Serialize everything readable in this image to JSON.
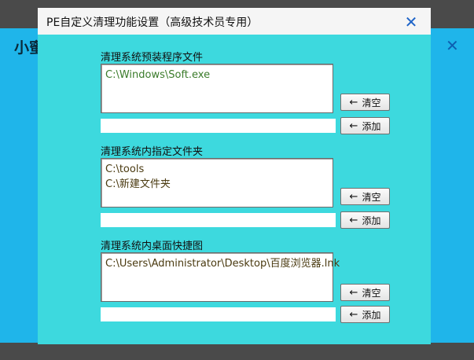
{
  "background_app": {
    "title": "小蜜",
    "close_glyph": "✕"
  },
  "dialog": {
    "title": "PE自定义清理功能设置（高级技术员专用）",
    "close_glyph": "✕",
    "sections": [
      {
        "label": "清理系统预装程序文件",
        "items": [
          "C:\\Windows\\Soft.exe"
        ],
        "input_value": "",
        "clear_label": "清空",
        "add_label": "添加"
      },
      {
        "label": "清理系统内指定文件夹",
        "items": [
          "C:\\tools",
          "C:\\新建文件夹"
        ],
        "input_value": "",
        "clear_label": "清空",
        "add_label": "添加"
      },
      {
        "label": "清理系统内桌面快捷图",
        "items": [
          "C:\\Users\\Administrator\\Desktop\\百度浏览器.lnk"
        ],
        "input_value": "",
        "clear_label": "清空",
        "add_label": "添加"
      }
    ]
  },
  "icons": {
    "arrow_glyph": "←"
  },
  "colors": {
    "dialog_bg": "#3dd9de",
    "app_bg": "#1fb5ea",
    "close_blue": "#1e64c8",
    "list_text_green": "#3a7b2a",
    "list_text_olive": "#4a3a10"
  }
}
